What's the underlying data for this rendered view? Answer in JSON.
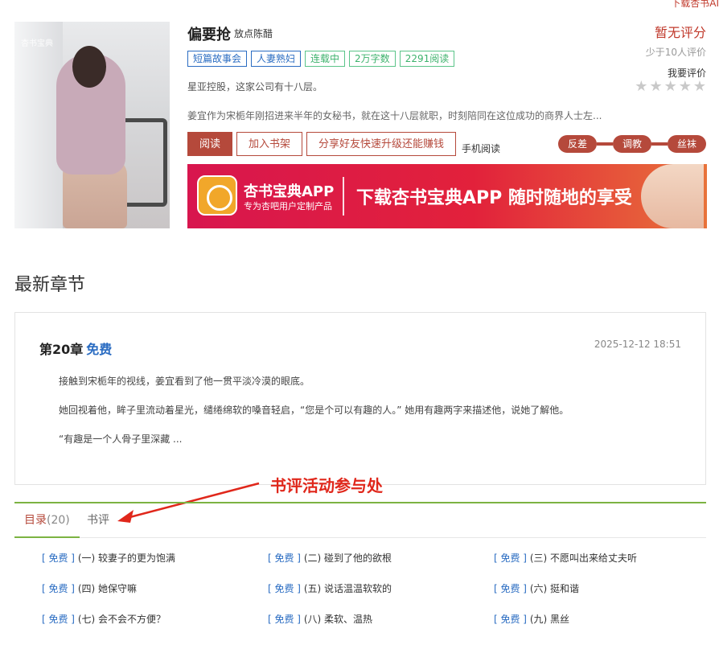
{
  "header": {
    "download_link": "下载杏书AI"
  },
  "book": {
    "title": "偏要抢",
    "author": "放点陈醋",
    "tags": [
      {
        "label": "短篇故事会",
        "color": "blue"
      },
      {
        "label": "人妻熟妇",
        "color": "blue"
      },
      {
        "label": "连载中",
        "color": "green"
      },
      {
        "label": "2万字数",
        "color": "green"
      },
      {
        "label": "2291阅读",
        "color": "green"
      }
    ],
    "company_line": "星亚控股，这家公司有十八层。",
    "description": "姜宜作为宋栀年刚招进来半年的女秘书，就在这十八层就职，时刻陪同在这位成功的商界人士左...",
    "cover_watermark": "杏书宝典"
  },
  "rating": {
    "score_text": "暂无评分",
    "count_text": "少于10人评价",
    "rate_link": "我要评价",
    "stars": [
      "★",
      "★",
      "★",
      "★",
      "★"
    ]
  },
  "actions": {
    "read": "阅读",
    "add_shelf": "加入书架",
    "share": "分享好友快速升级还能赚钱",
    "mobile_read": "手机阅读"
  },
  "chips": [
    "反差",
    "调教",
    "丝袜"
  ],
  "banner": {
    "app_name": "杏书宝典APP",
    "app_sub": "专为杏吧用户定制产品",
    "slogan": "下载杏书宝典APP 随时随地的享受"
  },
  "latest": {
    "section_title": "最新章节",
    "chapter_title": "第20章",
    "chapter_free": "免费",
    "date": "2025-12-12 18:51",
    "paragraphs": [
      "接触到宋栀年的视线，姜宜看到了他一贯平淡冷漠的眼底。",
      "她回视着他，眸子里流动着星光，缱绻绵软的嗓音轻启，“您是个可以有趣的人。” 她用有趣两字来描述他，说她了解他。",
      "“有趣是一个人骨子里深藏 ..."
    ]
  },
  "annotation": {
    "text": "书评活动参与处"
  },
  "tabs": {
    "toc_label": "目录",
    "toc_count": "(20)",
    "review_label": "书评"
  },
  "toc": [
    {
      "fee": "[ 免费 ]",
      "title": "(一) 较妻子的更为饱满"
    },
    {
      "fee": "[ 免费 ]",
      "title": "(二) 碰到了他的欲根"
    },
    {
      "fee": "[ 免费 ]",
      "title": "(三) 不愿叫出来给丈夫听"
    },
    {
      "fee": "[ 免费 ]",
      "title": "(四) 她保守嘛"
    },
    {
      "fee": "[ 免费 ]",
      "title": "(五) 说话温温软软的"
    },
    {
      "fee": "[ 免费 ]",
      "title": "(六) 挺和谐"
    },
    {
      "fee": "[ 免费 ]",
      "title": "(七) 会不会不方便？"
    },
    {
      "fee": "[ 免费 ]",
      "title": "(八) 柔软、温热"
    },
    {
      "fee": "[ 免费 ]",
      "title": "(九) 黑丝"
    }
  ]
}
